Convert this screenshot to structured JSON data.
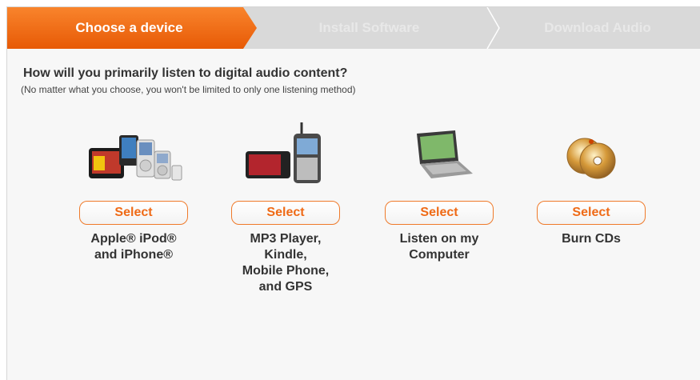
{
  "steps": [
    {
      "label": "Choose a device",
      "active": true
    },
    {
      "label": "Install Software",
      "active": false
    },
    {
      "label": "Download Audio",
      "active": false
    }
  ],
  "question": "How will you primarily listen to digital audio content?",
  "subnote": "(No matter what you choose, you won't be limited to only one listening method)",
  "options": [
    {
      "icon": "ipod-iphone-image",
      "button": "Select",
      "label": "Apple® iPod®\nand iPhone®"
    },
    {
      "icon": "mp3-player-phone-image",
      "button": "Select",
      "label": "MP3 Player,\nKindle,\nMobile Phone,\nand GPS"
    },
    {
      "icon": "laptop-image",
      "button": "Select",
      "label": "Listen on my\nComputer"
    },
    {
      "icon": "cd-discs-image",
      "button": "Select",
      "label": "Burn CDs"
    }
  ],
  "colors": {
    "accent": "#ef6a16",
    "step_inactive": "#d9d9d9"
  }
}
